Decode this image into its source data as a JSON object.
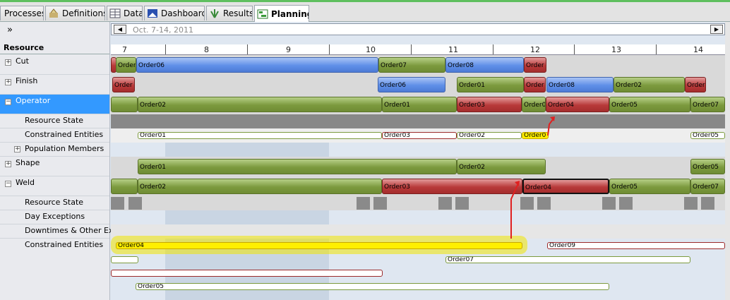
{
  "tabs": [
    {
      "label": "Processes",
      "icon": "processes-icon"
    },
    {
      "label": "Definitions",
      "icon": "definitions-icon"
    },
    {
      "label": "Data",
      "icon": "data-table-icon"
    },
    {
      "label": "Dashboard",
      "icon": "dashboard-icon"
    },
    {
      "label": "Results",
      "icon": "results-icon"
    },
    {
      "label": "Planning",
      "icon": "planning-icon"
    }
  ],
  "collapse_glyph": "»",
  "date_range": "Oct. 7-14, 2011",
  "nav": {
    "prev": "◀",
    "next": "▶"
  },
  "resource_header": "Resource",
  "day_labels": [
    "7",
    "8",
    "9",
    "10",
    "11",
    "12",
    "13",
    "14"
  ],
  "rows": {
    "cut": "Cut",
    "finish": "Finish",
    "operator": "Operator",
    "resource_state": "Resource State",
    "constrained_entities": "Constrained Entities",
    "population_members": "Population Members",
    "shape": "Shape",
    "weld": "Weld",
    "weld_resource_state": "Resource State",
    "day_exceptions": "Day Exceptions",
    "downtimes": "Downtimes & Other Ex",
    "weld_constrained_entities": "Constrained Entities"
  },
  "expander": {
    "plus": "+",
    "minus": "−"
  },
  "bars": {
    "cut": [
      "Order",
      "Order06",
      "Order07",
      "Order08",
      "Order"
    ],
    "finish": [
      "Order",
      "Order06",
      "Order01",
      "Order",
      "Order08",
      "Order02",
      "Order"
    ],
    "operator": [
      "Order02",
      "Order01",
      "Order03",
      "Order0",
      "Order04",
      "Order05",
      "Order07"
    ],
    "operator_entities": [
      "Order01",
      "Order03",
      "Order02",
      "Order0",
      "Order05"
    ],
    "shape": [
      "Order01",
      "Order02",
      "Order05"
    ],
    "weld": [
      "Order02",
      "Order03",
      "Order04",
      "Order05",
      "Order07"
    ],
    "weld_entities": [
      "Order04",
      "Order09",
      "Order07",
      "Order05"
    ]
  },
  "colors": {
    "green": "#7c9a3e",
    "blue": "#5f8fe8",
    "red": "#b83a3a",
    "highlight": "#ffef00",
    "selected_row": "#3399ff"
  }
}
